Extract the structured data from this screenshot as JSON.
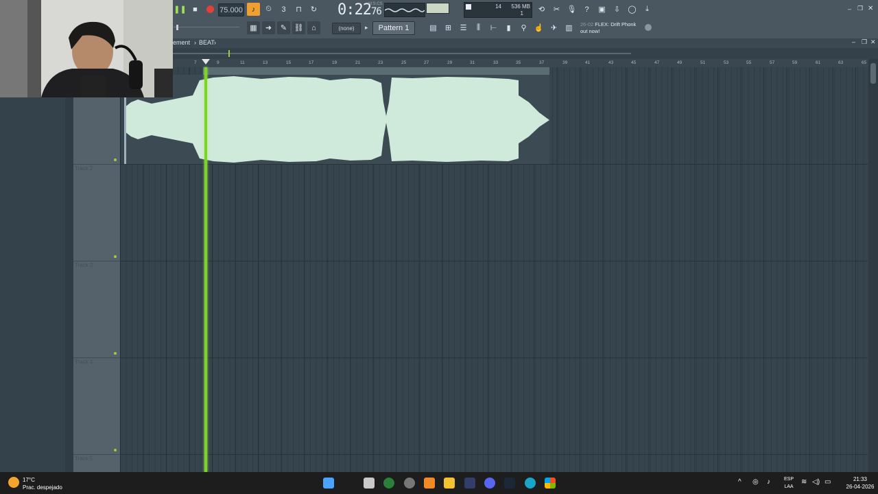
{
  "transport": {
    "tempo": "75.000",
    "time": "0:22",
    "time_frac": "76",
    "time_unit": "M:S:CS",
    "cpu_value": "14",
    "memory": "536 MB",
    "voices": "1"
  },
  "toolbar2": {
    "snap_label": "(none)",
    "pattern": "Pattern 1"
  },
  "news": {
    "number": "26-02",
    "text_line1": "FLEX: Drift Phonk",
    "text_line2": "out now!"
  },
  "playlist": {
    "breadcrumb_prefix": "ement",
    "breadcrumb_sep": "›",
    "breadcrumb_current": "BEAT",
    "ruler_marks": [
      "9",
      "11",
      "13",
      "15",
      "17",
      "19",
      "21",
      "23",
      "25",
      "27",
      "29",
      "31",
      "33",
      "35",
      "37",
      "39",
      "41",
      "43",
      "45",
      "47",
      "49",
      "51",
      "53",
      "55",
      "57",
      "59",
      "61",
      "63",
      "65"
    ],
    "ruler_small": [
      "7"
    ],
    "tracks": [
      "Track 2",
      "Track 3",
      "Track 4",
      "Track 5"
    ]
  },
  "taskbar": {
    "temperature": "17°C",
    "weather": "Prac. despejado",
    "lang_top": "ESP",
    "lang_bottom": "LAA",
    "clock_time": "21:33",
    "clock_date": "26-04-2026"
  },
  "colors": {
    "playhead": "#7fd12b",
    "waveform": "#cfe9da",
    "toolbar_bg": "#4a5660",
    "grid_bg": "#36444e"
  },
  "icons": [
    "pause-icon",
    "stop-icon",
    "record-icon",
    "metronome-icon",
    "wait-icon",
    "countdown-icon",
    "step-icon",
    "loop-record-icon",
    "scope",
    "piano-roll-icon",
    "playlist-icon",
    "channel-rack-icon",
    "mixer-icon",
    "browser-icon",
    "plugin-icon",
    "help-icon",
    "save-icon",
    "settings-icon",
    "chat-icon",
    "download-icon"
  ]
}
